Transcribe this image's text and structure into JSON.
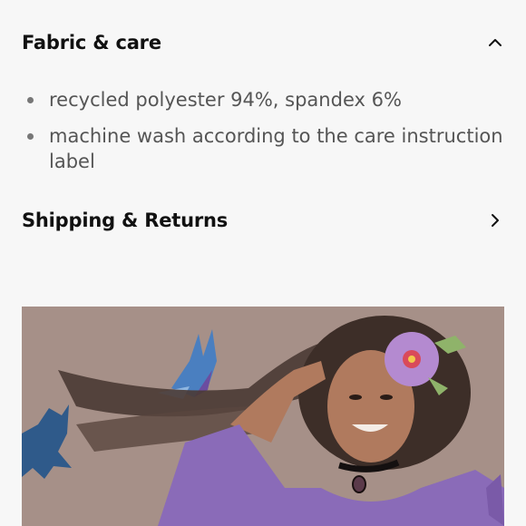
{
  "fabric_care": {
    "title": "Fabric & care",
    "items": [
      "recycled polyester 94%, spandex 6%",
      "machine wash according to the care instruction label"
    ]
  },
  "shipping": {
    "title": "Shipping & Returns"
  },
  "icons": {
    "fabric_toggle": "chevron-up-icon",
    "shipping_toggle": "chevron-right-icon"
  },
  "colors": {
    "hero_background": "#a69088",
    "sweatshirt": "#8a6bb8"
  }
}
